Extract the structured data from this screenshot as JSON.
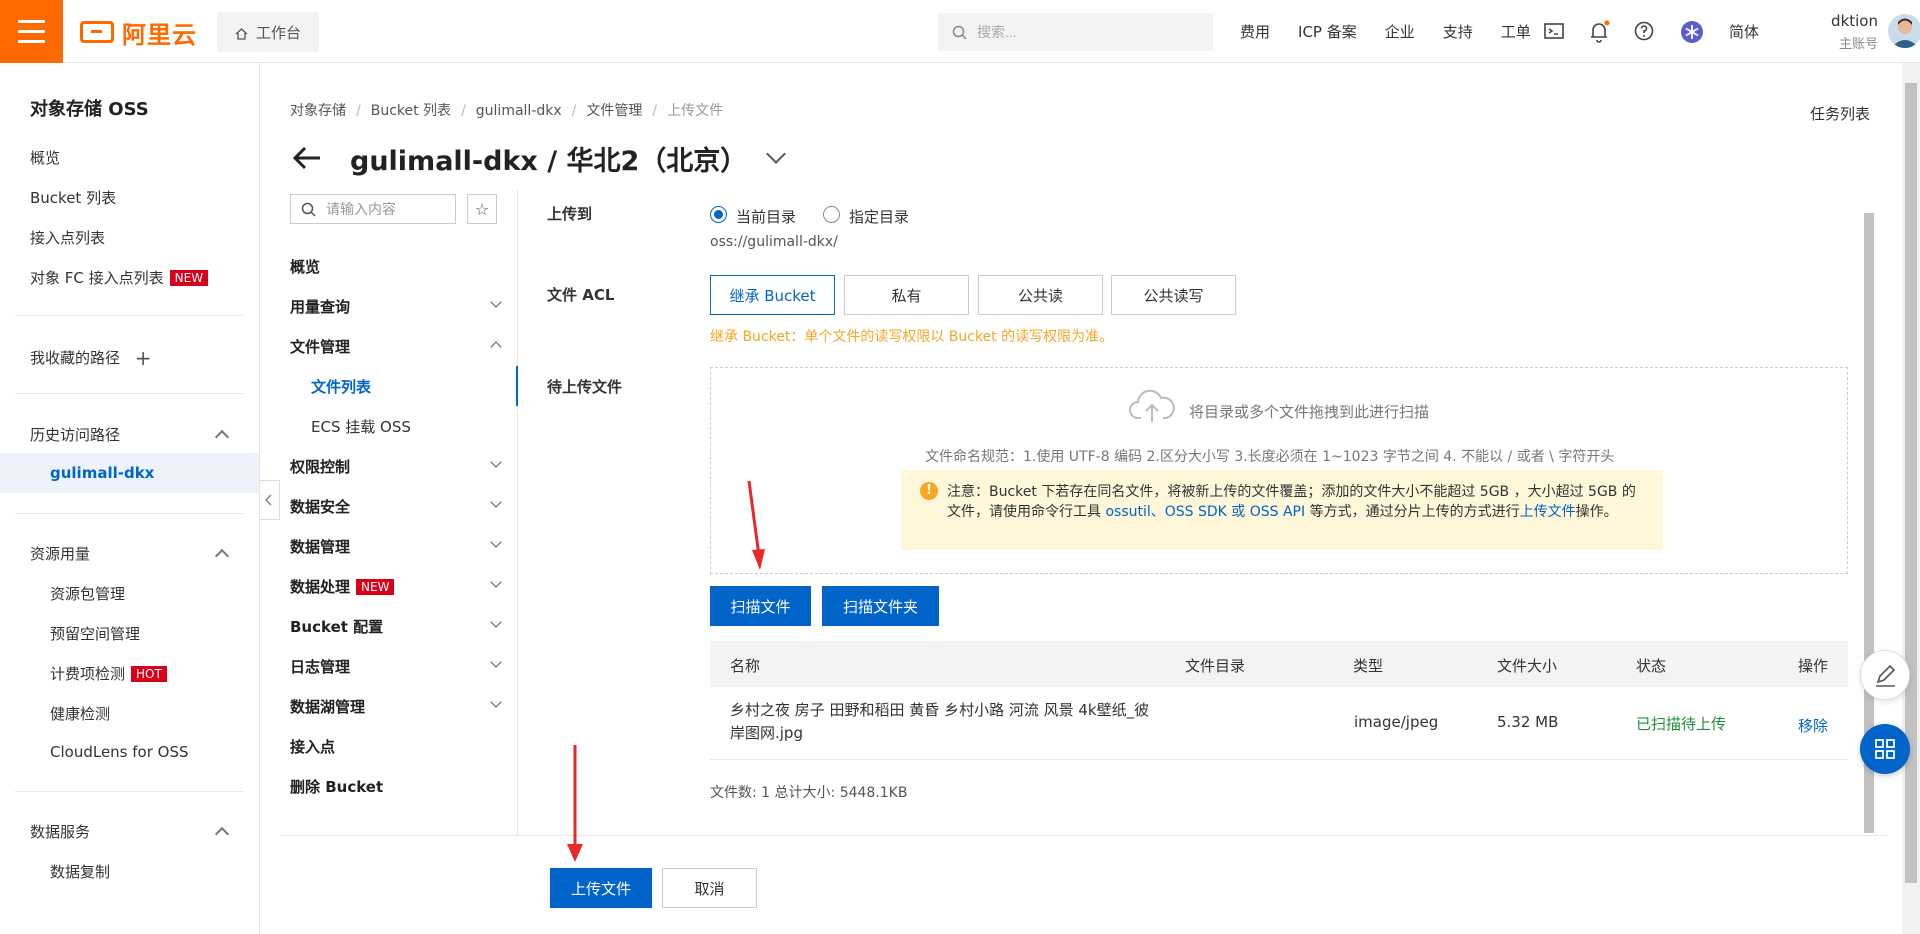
{
  "topbar": {
    "logo_text": "阿里云",
    "workbench": "工作台",
    "search_placeholder": "搜索...",
    "nav": [
      "费用",
      "ICP 备案",
      "企业",
      "支持",
      "工单"
    ],
    "lang": "简体",
    "username": "dktion",
    "role": "主账号",
    "accent": "#ff6a00"
  },
  "sidebar": {
    "title": "对象存储 OSS",
    "items": [
      "概览",
      "Bucket 列表",
      "接入点列表",
      "对象 FC 接入点列表"
    ],
    "new_badge": "NEW",
    "favorites": "我收藏的路径",
    "history_title": "历史访问路径",
    "history_active": "gulimall-dkx",
    "resource_title": "资源用量",
    "resource_items": [
      "资源包管理",
      "预留空间管理",
      "计费项检测",
      "健康检测",
      "CloudLens for OSS"
    ],
    "hot_badge": "HOT",
    "data_service_title": "数据服务",
    "data_service_items": [
      "数据复制"
    ]
  },
  "breadcrumb": [
    "对象存储",
    "Bucket 列表",
    "gulimall-dkx",
    "文件管理",
    "上传文件"
  ],
  "task_list": "任务列表",
  "page_title": "gulimall-dkx / 华北2（北京）",
  "subnav": {
    "search_placeholder": "请输入内容",
    "items": [
      "概览",
      "用量查询",
      "文件管理",
      "文件列表",
      "ECS 挂载 OSS",
      "权限控制",
      "数据安全",
      "数据管理",
      "数据处理",
      "Bucket 配置",
      "日志管理",
      "数据湖管理",
      "接入点",
      "删除 Bucket"
    ],
    "new_badge": "NEW"
  },
  "form": {
    "upload_to_label": "上传到",
    "radio_current": "当前目录",
    "radio_specified": "指定目录",
    "oss_path": "oss://gulimall-dkx/",
    "acl_label": "文件 ACL",
    "acl_options": [
      "继承 Bucket",
      "私有",
      "公共读",
      "公共读写"
    ],
    "acl_note": "继承 Bucket：单个文件的读写权限以 Bucket 的读写权限为准。",
    "pending_label": "待上传文件",
    "drop_text": "将目录或多个文件拖拽到此进行扫描",
    "drop_rule": "文件命名规范：1.使用 UTF-8 编码 2.区分大小写 3.长度必须在 1~1023 字节之间 4. 不能以 / 或者 \\ 字符开头",
    "warn_prefix": "注意：Bucket 下若存在同名文件，将被新上传的文件覆盖；添加的文件大小不能超过 5GB ，大小超过 5GB 的文件，请使用命令行工具 ",
    "warn_link1": "ossutil、OSS SDK 或 OSS API",
    "warn_mid": " 等方式，通过分片上传的方式进行",
    "warn_link2": "上传文件",
    "warn_suffix": "操作。",
    "scan_files": "扫描文件",
    "scan_folder": "扫描文件夹"
  },
  "table": {
    "headers": [
      "名称",
      "文件目录",
      "类型",
      "文件大小",
      "状态",
      "操作"
    ],
    "rows": [
      {
        "name": "乡村之夜 房子 田野和稻田 黄昏 乡村小路 河流 风景 4k壁纸_彼岸图网.jpg",
        "dir": "",
        "type": "image/jpeg",
        "size": "5.32 MB",
        "status": "已扫描待上传",
        "action": "移除"
      }
    ]
  },
  "summary": "文件数: 1   总计大小: 5448.1KB",
  "footer": {
    "upload": "上传文件",
    "cancel": "取消"
  }
}
